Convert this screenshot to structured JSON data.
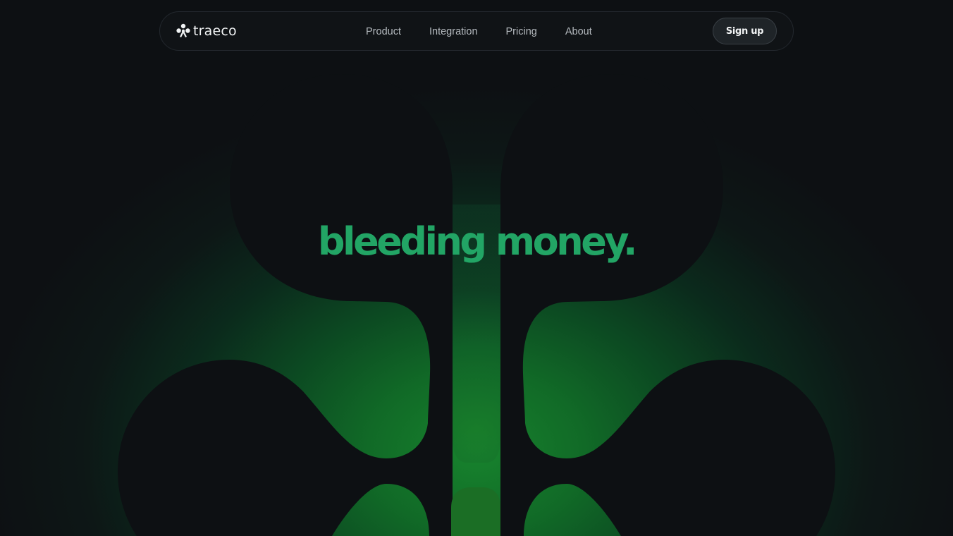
{
  "colors": {
    "page_background": "#0d1013",
    "glow_green": "#17832d",
    "headline_green": "#22a565",
    "shape_dark": "#0d1013",
    "nav_text": "#b4b9be",
    "brand_text": "#f1f3f4"
  },
  "navbar": {
    "brand": {
      "name": "traeco",
      "icon": "traeco-logo-icon"
    },
    "links": [
      {
        "label": "Product"
      },
      {
        "label": "Integration"
      },
      {
        "label": "Pricing"
      },
      {
        "label": "About"
      }
    ],
    "signup_label": "Sign up"
  },
  "hero": {
    "headline": "bleeding money.",
    "art": "dark clover / leaf silhouette over green glow"
  }
}
